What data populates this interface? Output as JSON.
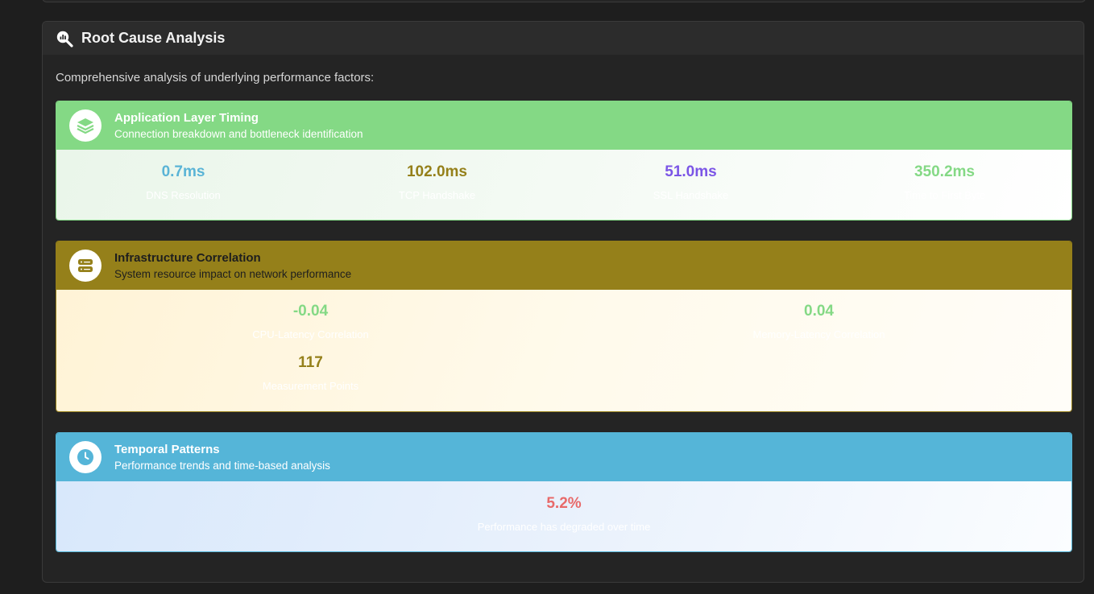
{
  "section": {
    "icon": "magnifier-chart-icon",
    "title": "Root Cause Analysis",
    "description": "Comprehensive analysis of underlying performance factors:"
  },
  "panels": {
    "application": {
      "icon": "layers-icon",
      "title": "Application Layer Timing",
      "subtitle": "Connection breakdown and bottleneck identification",
      "header_color": "#84d985",
      "metrics": [
        {
          "value": "0.7ms",
          "label": "DNS Resolution",
          "color": "#5ab4d6"
        },
        {
          "value": "102.0ms",
          "label": "TCP Handshake",
          "color": "#95801a"
        },
        {
          "value": "51.0ms",
          "label": "SSL Handshake",
          "color": "#7b55e6"
        },
        {
          "value": "350.2ms",
          "label": "Time to First Byte",
          "color": "#84d985"
        }
      ]
    },
    "infrastructure": {
      "icon": "server-icon",
      "title": "Infrastructure Correlation",
      "subtitle": "System resource impact on network performance",
      "header_color": "#95801a",
      "metrics": [
        {
          "value": "-0.04",
          "label": "CPU-Latency Correlation",
          "color": "#84d985"
        },
        {
          "value": "0.04",
          "label": "Memory-Latency Correlation",
          "color": "#84d985"
        },
        {
          "value": "117",
          "label": "Measurement Points",
          "color": "#95801a"
        }
      ]
    },
    "temporal": {
      "icon": "clock-icon",
      "title": "Temporal Patterns",
      "subtitle": "Performance trends and time-based analysis",
      "header_color": "#55b5d8",
      "metrics": [
        {
          "value": "5.2%",
          "label": "Performance has degraded over time",
          "color": "#e86a6a"
        }
      ]
    }
  }
}
